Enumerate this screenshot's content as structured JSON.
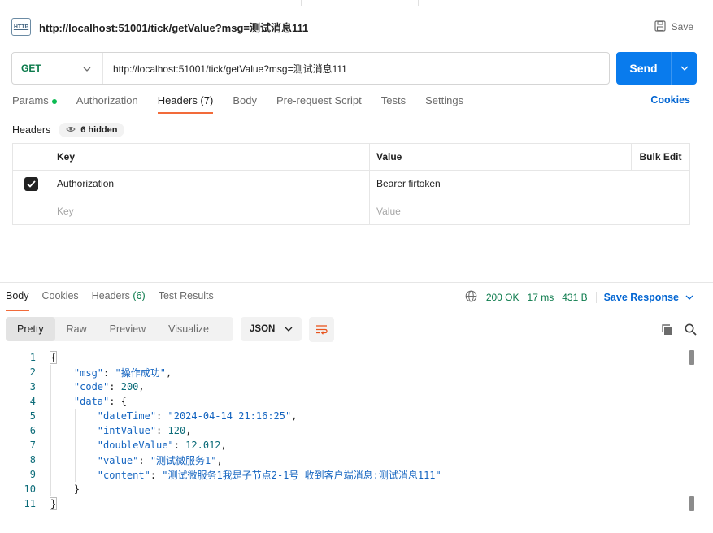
{
  "request": {
    "title": "http://localhost:51001/tick/getValue?msg=测试消息111",
    "icon_text": "HTTP",
    "save_label": "Save",
    "method": "GET",
    "url": "http://localhost:51001/tick/getValue?msg=测试消息111",
    "send_label": "Send"
  },
  "request_tabs": [
    {
      "label": "Params"
    },
    {
      "label": "Authorization"
    },
    {
      "label": "Headers (7)"
    },
    {
      "label": "Body"
    },
    {
      "label": "Pre-request Script"
    },
    {
      "label": "Tests"
    },
    {
      "label": "Settings"
    }
  ],
  "cookies_label": "Cookies",
  "headers_section": {
    "label": "Headers",
    "hidden_chip": "6 hidden",
    "columns": {
      "key": "Key",
      "value": "Value",
      "bulk_edit": "Bulk Edit"
    },
    "rows": [
      {
        "key": "Authorization",
        "value": "Bearer firtoken",
        "checked": true
      }
    ],
    "placeholder_key": "Key",
    "placeholder_value": "Value"
  },
  "response_tabs": [
    {
      "label": "Body"
    },
    {
      "label": "Cookies"
    },
    {
      "label": "Headers",
      "count": "(6)"
    },
    {
      "label": "Test Results"
    }
  ],
  "response_status": {
    "status": "200 OK",
    "time": "17 ms",
    "size": "431 B",
    "save_label": "Save Response"
  },
  "view_tabs": [
    "Pretty",
    "Raw",
    "Preview",
    "Visualize"
  ],
  "format": "JSON",
  "colors": {
    "accent": "#097bed",
    "active_tab_underline": "#f26b3a",
    "status_green": "#0b7a4b",
    "link_blue": "#0265d2"
  },
  "code_lines": [
    {
      "n": "1",
      "parts": [
        [
          "p",
          "{"
        ]
      ]
    },
    {
      "n": "2",
      "parts": [
        [
          "p",
          "    "
        ],
        [
          "k",
          "\"msg\""
        ],
        [
          "p",
          ": "
        ],
        [
          "s",
          "\"操作成功\""
        ],
        [
          "p",
          ","
        ]
      ]
    },
    {
      "n": "3",
      "parts": [
        [
          "p",
          "    "
        ],
        [
          "k",
          "\"code\""
        ],
        [
          "p",
          ": "
        ],
        [
          "n",
          "200"
        ],
        [
          "p",
          ","
        ]
      ]
    },
    {
      "n": "4",
      "parts": [
        [
          "p",
          "    "
        ],
        [
          "k",
          "\"data\""
        ],
        [
          "p",
          ": {"
        ]
      ]
    },
    {
      "n": "5",
      "parts": [
        [
          "p",
          "        "
        ],
        [
          "k",
          "\"dateTime\""
        ],
        [
          "p",
          ": "
        ],
        [
          "s",
          "\"2024-04-14 21:16:25\""
        ],
        [
          "p",
          ","
        ]
      ]
    },
    {
      "n": "6",
      "parts": [
        [
          "p",
          "        "
        ],
        [
          "k",
          "\"intValue\""
        ],
        [
          "p",
          ": "
        ],
        [
          "n",
          "120"
        ],
        [
          "p",
          ","
        ]
      ]
    },
    {
      "n": "7",
      "parts": [
        [
          "p",
          "        "
        ],
        [
          "k",
          "\"doubleValue\""
        ],
        [
          "p",
          ": "
        ],
        [
          "n",
          "12.012"
        ],
        [
          "p",
          ","
        ]
      ]
    },
    {
      "n": "8",
      "parts": [
        [
          "p",
          "        "
        ],
        [
          "k",
          "\"value\""
        ],
        [
          "p",
          ": "
        ],
        [
          "s",
          "\"测试微服务1\""
        ],
        [
          "p",
          ","
        ]
      ]
    },
    {
      "n": "9",
      "parts": [
        [
          "p",
          "        "
        ],
        [
          "k",
          "\"content\""
        ],
        [
          "p",
          ": "
        ],
        [
          "s",
          "\"测试微服务1我是子节点2-1号 收到客户端消息:测试消息111\""
        ]
      ]
    },
    {
      "n": "10",
      "parts": [
        [
          "p",
          "    }"
        ]
      ]
    },
    {
      "n": "11",
      "parts": [
        [
          "p",
          "}"
        ]
      ]
    }
  ]
}
